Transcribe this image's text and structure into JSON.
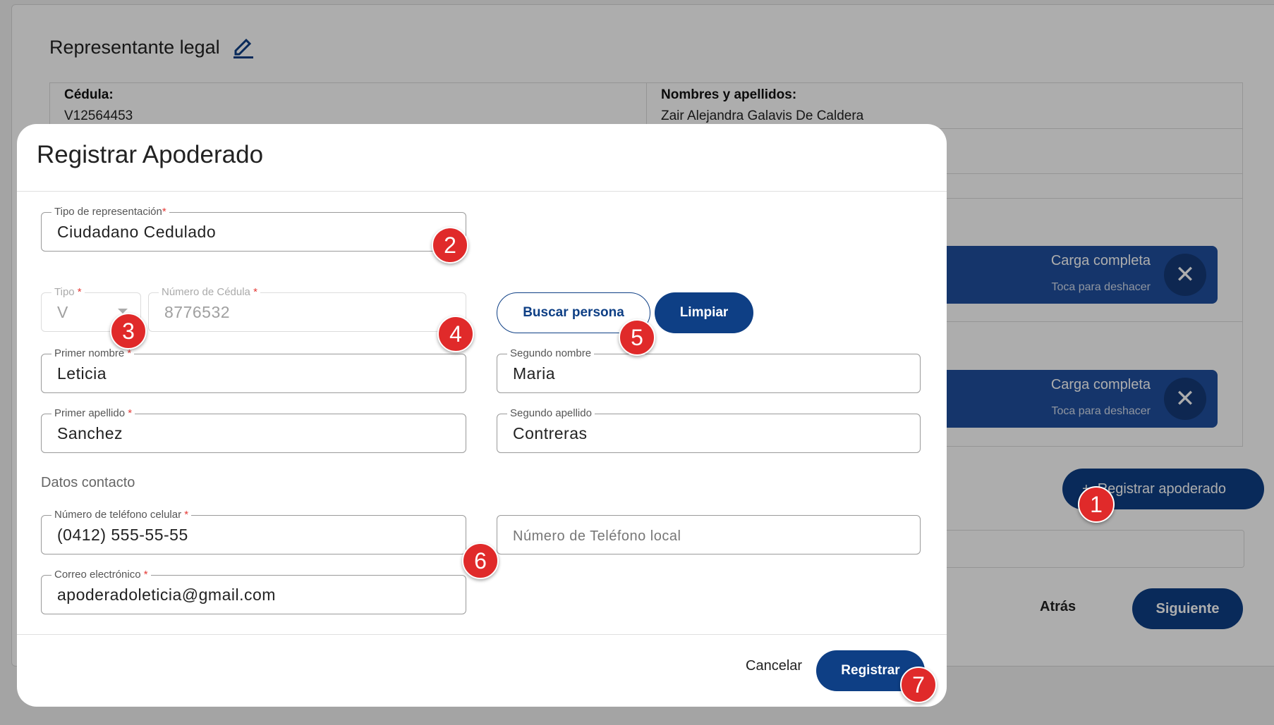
{
  "background": {
    "section_title": "Representante legal",
    "cedula_label": "Cédula:",
    "cedula_value": "V12564453",
    "nombres_label": "Nombres y apellidos:",
    "nombres_value": "Zair Alejandra Galavis De Caldera",
    "toasts": [
      {
        "title": "Carga completa",
        "subtitle": "Toca para deshacer"
      },
      {
        "title": "Carga completa",
        "subtitle": "Toca para deshacer"
      }
    ],
    "register_button": "Registrar apoderado",
    "back_button": "Atrás",
    "next_button": "Siguiente"
  },
  "modal": {
    "title": "Registrar Apoderado",
    "tipo_representacion": {
      "label": "Tipo de representación",
      "value": "Ciudadano Cedulado"
    },
    "tipo": {
      "label": "Tipo",
      "value": "V"
    },
    "numero_cedula": {
      "label": "Número de Cédula",
      "value": "8776532"
    },
    "buscar_button": "Buscar persona",
    "limpiar_button": "Limpiar",
    "primer_nombre": {
      "label": "Primer nombre",
      "value": "Leticia"
    },
    "segundo_nombre": {
      "label": "Segundo nombre",
      "value": "Maria"
    },
    "primer_apellido": {
      "label": "Primer apellido",
      "value": "Sanchez"
    },
    "segundo_apellido": {
      "label": "Segundo apellido",
      "value": "Contreras"
    },
    "datos_contacto": "Datos contacto",
    "telefono_celular": {
      "label": "Número de teléfono celular",
      "value": "(0412) 555-55-55"
    },
    "telefono_local": {
      "placeholder": "Número de Teléfono local"
    },
    "correo": {
      "label": "Correo electrónico",
      "value": "apoderadoleticia@gmail.com"
    },
    "required_mark": "*",
    "cancel_button": "Cancelar",
    "submit_button": "Registrar"
  },
  "markers": [
    "1",
    "2",
    "3",
    "4",
    "5",
    "6",
    "7"
  ],
  "colors": {
    "primary": "#0e3f85",
    "toast": "#1f4f9e",
    "marker": "#e02a2a",
    "required": "#e53935"
  }
}
